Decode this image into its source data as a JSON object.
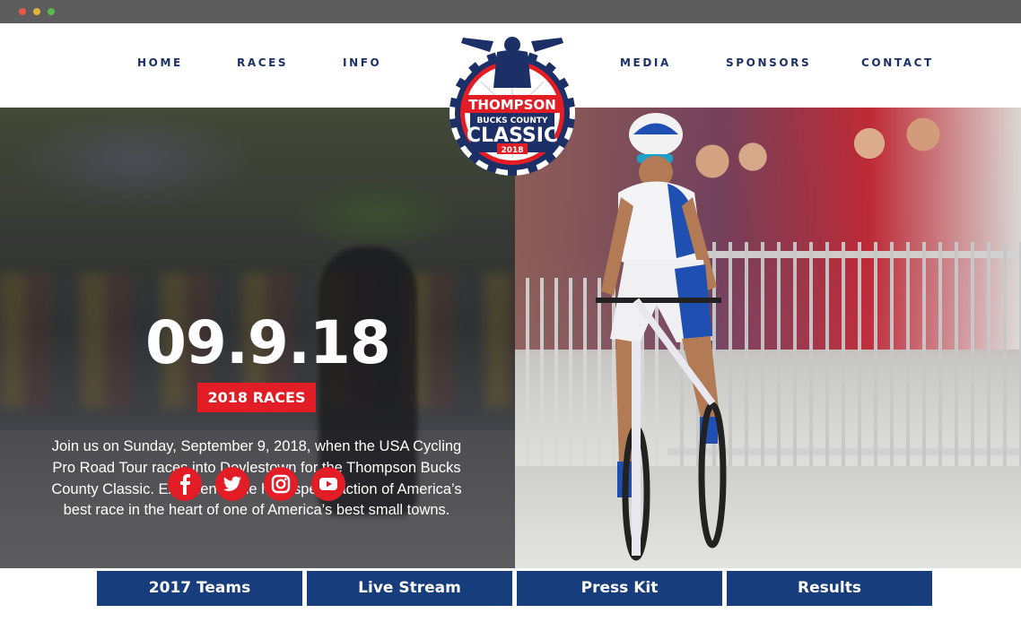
{
  "nav": {
    "left": [
      "HOME",
      "RACES",
      "INFO"
    ],
    "right": [
      "MEDIA",
      "SPONSORS",
      "CONTACT"
    ]
  },
  "logo": {
    "line1": "THOMPSON",
    "line2": "BUCKS COUNTY",
    "line3": "CLASSIC",
    "year": "2018"
  },
  "hero": {
    "date": "09.9.18",
    "races_button": "2018 RACES",
    "intro": "Join us on Sunday, September 9, 2018, when the USA Cycling Pro Road Tour races into Doylestown for the Thompson Bucks County Classic. Experience the high speed action of America’s best race in the heart of one of America’s best small towns."
  },
  "social": [
    "facebook-icon",
    "twitter-icon",
    "instagram-icon",
    "youtube-icon"
  ],
  "bottom_buttons": [
    "2017 Teams",
    "Live Stream",
    "Press Kit",
    "Results"
  ],
  "colors": {
    "navy": "#1c2f66",
    "button_blue": "#173d7c",
    "red": "#e31d25"
  }
}
